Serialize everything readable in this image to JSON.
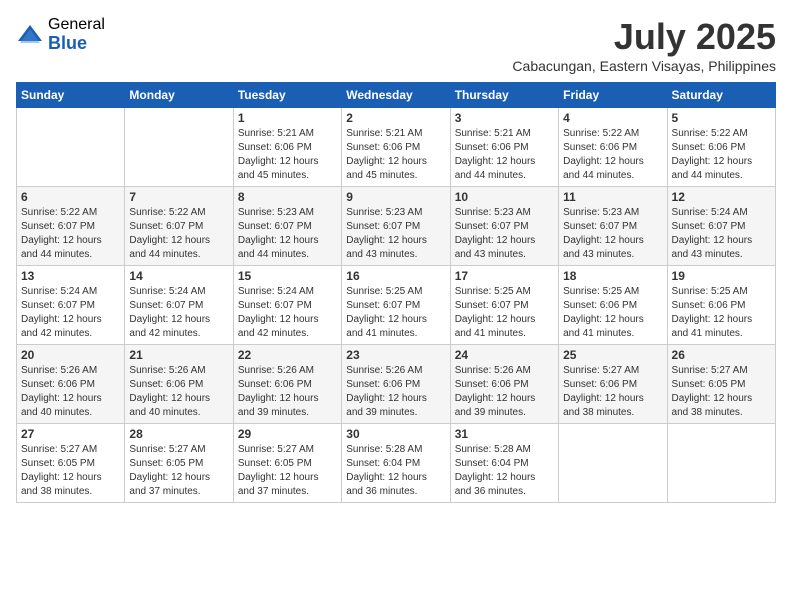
{
  "logo": {
    "general": "General",
    "blue": "Blue"
  },
  "header": {
    "month_year": "July 2025",
    "location": "Cabacungan, Eastern Visayas, Philippines"
  },
  "weekdays": [
    "Sunday",
    "Monday",
    "Tuesday",
    "Wednesday",
    "Thursday",
    "Friday",
    "Saturday"
  ],
  "weeks": [
    [
      {
        "day": "",
        "info": ""
      },
      {
        "day": "",
        "info": ""
      },
      {
        "day": "1",
        "info": "Sunrise: 5:21 AM\nSunset: 6:06 PM\nDaylight: 12 hours and 45 minutes."
      },
      {
        "day": "2",
        "info": "Sunrise: 5:21 AM\nSunset: 6:06 PM\nDaylight: 12 hours and 45 minutes."
      },
      {
        "day": "3",
        "info": "Sunrise: 5:21 AM\nSunset: 6:06 PM\nDaylight: 12 hours and 44 minutes."
      },
      {
        "day": "4",
        "info": "Sunrise: 5:22 AM\nSunset: 6:06 PM\nDaylight: 12 hours and 44 minutes."
      },
      {
        "day": "5",
        "info": "Sunrise: 5:22 AM\nSunset: 6:06 PM\nDaylight: 12 hours and 44 minutes."
      }
    ],
    [
      {
        "day": "6",
        "info": "Sunrise: 5:22 AM\nSunset: 6:07 PM\nDaylight: 12 hours and 44 minutes."
      },
      {
        "day": "7",
        "info": "Sunrise: 5:22 AM\nSunset: 6:07 PM\nDaylight: 12 hours and 44 minutes."
      },
      {
        "day": "8",
        "info": "Sunrise: 5:23 AM\nSunset: 6:07 PM\nDaylight: 12 hours and 44 minutes."
      },
      {
        "day": "9",
        "info": "Sunrise: 5:23 AM\nSunset: 6:07 PM\nDaylight: 12 hours and 43 minutes."
      },
      {
        "day": "10",
        "info": "Sunrise: 5:23 AM\nSunset: 6:07 PM\nDaylight: 12 hours and 43 minutes."
      },
      {
        "day": "11",
        "info": "Sunrise: 5:23 AM\nSunset: 6:07 PM\nDaylight: 12 hours and 43 minutes."
      },
      {
        "day": "12",
        "info": "Sunrise: 5:24 AM\nSunset: 6:07 PM\nDaylight: 12 hours and 43 minutes."
      }
    ],
    [
      {
        "day": "13",
        "info": "Sunrise: 5:24 AM\nSunset: 6:07 PM\nDaylight: 12 hours and 42 minutes."
      },
      {
        "day": "14",
        "info": "Sunrise: 5:24 AM\nSunset: 6:07 PM\nDaylight: 12 hours and 42 minutes."
      },
      {
        "day": "15",
        "info": "Sunrise: 5:24 AM\nSunset: 6:07 PM\nDaylight: 12 hours and 42 minutes."
      },
      {
        "day": "16",
        "info": "Sunrise: 5:25 AM\nSunset: 6:07 PM\nDaylight: 12 hours and 41 minutes."
      },
      {
        "day": "17",
        "info": "Sunrise: 5:25 AM\nSunset: 6:07 PM\nDaylight: 12 hours and 41 minutes."
      },
      {
        "day": "18",
        "info": "Sunrise: 5:25 AM\nSunset: 6:06 PM\nDaylight: 12 hours and 41 minutes."
      },
      {
        "day": "19",
        "info": "Sunrise: 5:25 AM\nSunset: 6:06 PM\nDaylight: 12 hours and 41 minutes."
      }
    ],
    [
      {
        "day": "20",
        "info": "Sunrise: 5:26 AM\nSunset: 6:06 PM\nDaylight: 12 hours and 40 minutes."
      },
      {
        "day": "21",
        "info": "Sunrise: 5:26 AM\nSunset: 6:06 PM\nDaylight: 12 hours and 40 minutes."
      },
      {
        "day": "22",
        "info": "Sunrise: 5:26 AM\nSunset: 6:06 PM\nDaylight: 12 hours and 39 minutes."
      },
      {
        "day": "23",
        "info": "Sunrise: 5:26 AM\nSunset: 6:06 PM\nDaylight: 12 hours and 39 minutes."
      },
      {
        "day": "24",
        "info": "Sunrise: 5:26 AM\nSunset: 6:06 PM\nDaylight: 12 hours and 39 minutes."
      },
      {
        "day": "25",
        "info": "Sunrise: 5:27 AM\nSunset: 6:06 PM\nDaylight: 12 hours and 38 minutes."
      },
      {
        "day": "26",
        "info": "Sunrise: 5:27 AM\nSunset: 6:05 PM\nDaylight: 12 hours and 38 minutes."
      }
    ],
    [
      {
        "day": "27",
        "info": "Sunrise: 5:27 AM\nSunset: 6:05 PM\nDaylight: 12 hours and 38 minutes."
      },
      {
        "day": "28",
        "info": "Sunrise: 5:27 AM\nSunset: 6:05 PM\nDaylight: 12 hours and 37 minutes."
      },
      {
        "day": "29",
        "info": "Sunrise: 5:27 AM\nSunset: 6:05 PM\nDaylight: 12 hours and 37 minutes."
      },
      {
        "day": "30",
        "info": "Sunrise: 5:28 AM\nSunset: 6:04 PM\nDaylight: 12 hours and 36 minutes."
      },
      {
        "day": "31",
        "info": "Sunrise: 5:28 AM\nSunset: 6:04 PM\nDaylight: 12 hours and 36 minutes."
      },
      {
        "day": "",
        "info": ""
      },
      {
        "day": "",
        "info": ""
      }
    ]
  ]
}
